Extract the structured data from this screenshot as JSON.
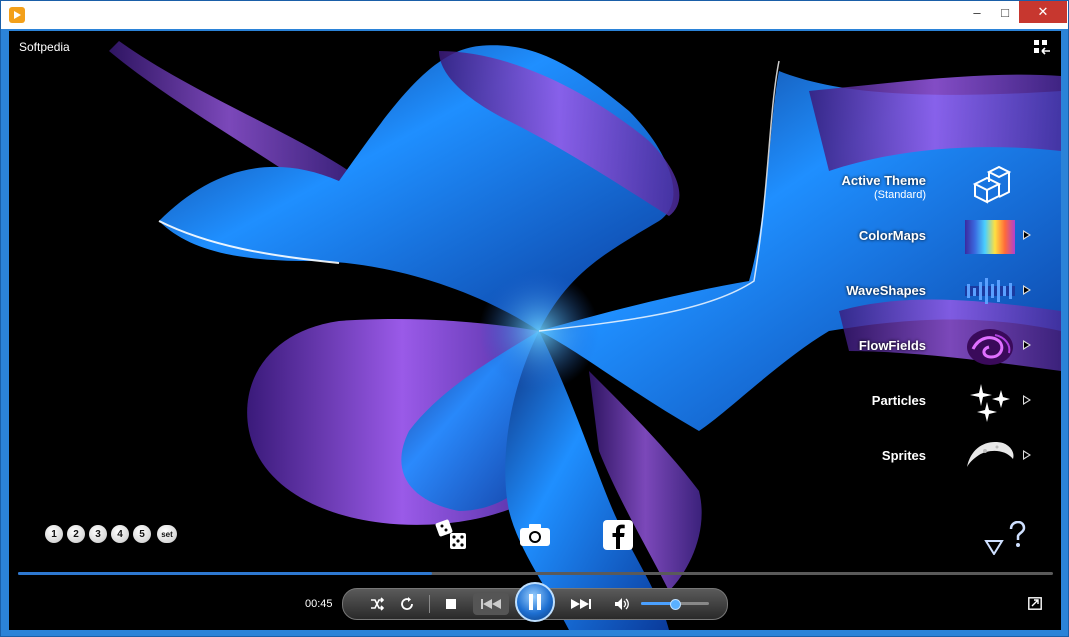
{
  "window": {
    "overlay_title": "Softpedia",
    "controls": {
      "minimize": "–",
      "maximize": "□",
      "close": "✕"
    }
  },
  "menu": {
    "active_theme": {
      "label": "Active Theme",
      "sub": "(Standard)"
    },
    "items": [
      {
        "label": "ColorMaps",
        "icon": "colormap-icon"
      },
      {
        "label": "WaveShapes",
        "icon": "waveshape-icon"
      },
      {
        "label": "FlowFields",
        "icon": "flowfield-icon"
      },
      {
        "label": "Particles",
        "icon": "particles-icon"
      },
      {
        "label": "Sprites",
        "icon": "sprites-icon"
      }
    ]
  },
  "presets": [
    "1",
    "2",
    "3",
    "4",
    "5"
  ],
  "preset_set_label": "set",
  "player": {
    "time": "00:45",
    "progress": 0.4,
    "volume": 0.5
  },
  "colors": {
    "accent": "#2e78d0",
    "viz_blue": "#1e8fff",
    "viz_purple": "#8a4fe0"
  }
}
